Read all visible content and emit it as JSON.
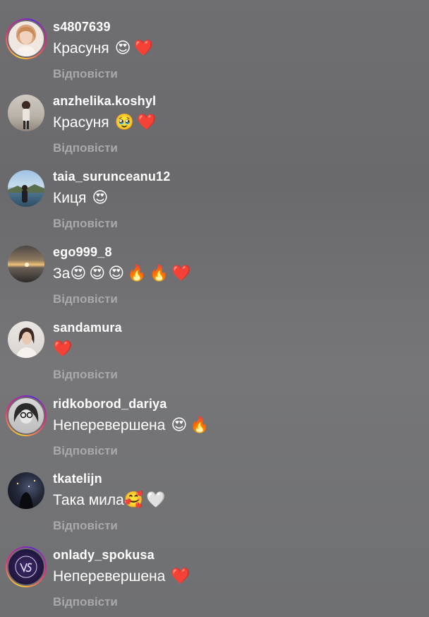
{
  "comments": [
    {
      "username": "s4807639",
      "text": "Красуня",
      "emojis": "😍❤️",
      "reply": "Відповісти",
      "avatar": "woman-portrait-icon",
      "ring": true
    },
    {
      "username": "anzhelika.koshyl",
      "text": "Красуня",
      "emojis": "🥹❤️",
      "reply": "Відповісти",
      "avatar": "person-standing-icon",
      "ring": false
    },
    {
      "username": "taia_surunceanu12",
      "text": "Киця",
      "emojis": "😍",
      "reply": "Відповісти",
      "avatar": "harbor-photo-icon",
      "ring": false
    },
    {
      "username": "ego999_8",
      "text": "За",
      "emojis": "😍😍😍🔥🔥❤️",
      "reply": "Відповісти",
      "avatar": "sunset-photo-icon",
      "ring": false
    },
    {
      "username": "sandamura",
      "text": "",
      "emojis": "❤️",
      "reply": "Відповісти",
      "avatar": "woman-photo-icon",
      "ring": false
    },
    {
      "username": "ridkoborod_dariya",
      "text": "Неперевершена",
      "emojis": "😍🔥",
      "reply": "Відповісти",
      "avatar": "woman-glasses-icon",
      "ring": true
    },
    {
      "username": "tkatelijn",
      "text": "Така мила",
      "emojis": "🥰🤍",
      "reply": "Відповісти",
      "avatar": "night-photo-icon",
      "ring": false
    },
    {
      "username": "onlady_spokusa",
      "text": "Неперевершена",
      "emojis": "❤️",
      "reply": "Відповісти",
      "avatar": "monogram-logo-icon",
      "ring": true
    }
  ]
}
